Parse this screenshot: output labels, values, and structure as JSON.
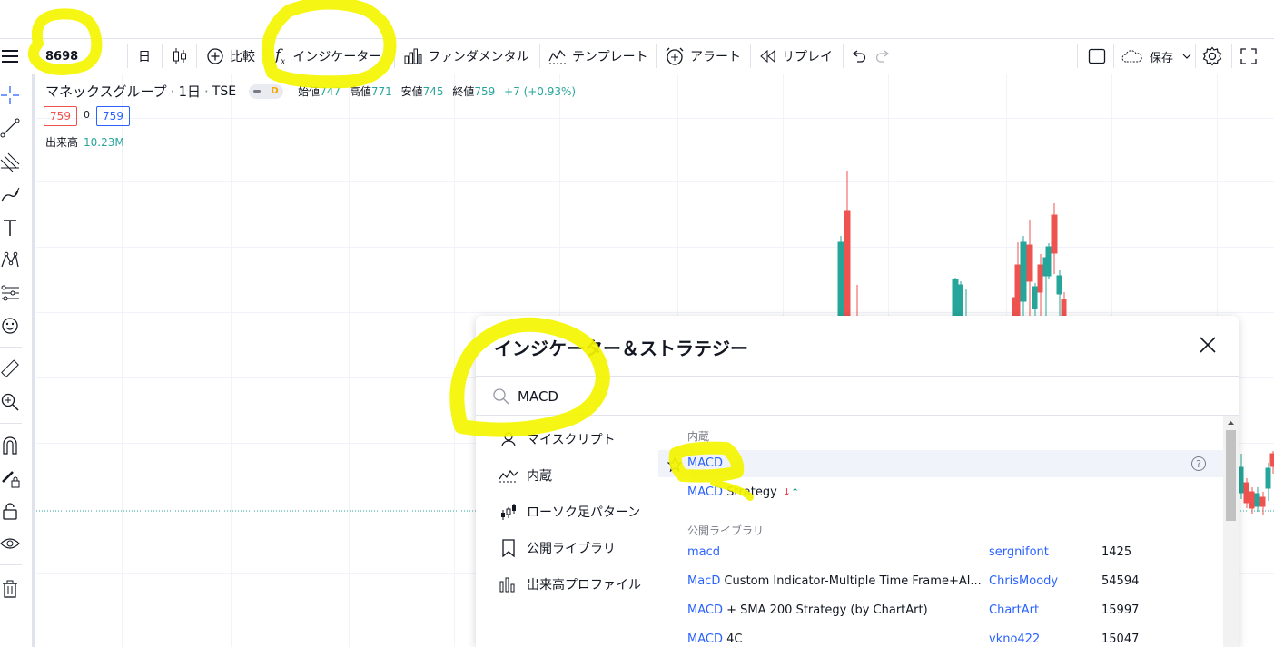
{
  "toolbar": {
    "symbol": "8698",
    "interval": "日",
    "compare": "比較",
    "indicators": "インジケーター",
    "fundamentals": "ファンダメンタル",
    "template": "テンプレート",
    "alert": "アラート",
    "replay": "リプレイ",
    "save": "保存"
  },
  "legend": {
    "name": "マネックスグループ",
    "interval": "1日",
    "exchange": "TSE",
    "pill_letter": "D",
    "open_label": "始値",
    "open": "747",
    "high_label": "高値",
    "high": "771",
    "low_label": "安値",
    "low": "745",
    "close_label": "終値",
    "close": "759",
    "change": "+7 (+0.93%)",
    "sell_price": "759",
    "spread": "0",
    "buy_price": "759",
    "volume_label": "出来高",
    "volume": "10.23M"
  },
  "dialog": {
    "title": "インジケーター＆ストラテジー",
    "search_value": "MACD",
    "categories": [
      {
        "icon": "user-icon",
        "label": "マイスクリプト"
      },
      {
        "icon": "builtin-chart-icon",
        "label": "内蔵"
      },
      {
        "icon": "candle-pattern-icon",
        "label": "ローソク足パターン"
      },
      {
        "icon": "bookmark-icon",
        "label": "公開ライブラリ"
      },
      {
        "icon": "volume-profile-icon",
        "label": "出来高プロファイル"
      }
    ],
    "builtin_header": "内蔵",
    "builtin": [
      {
        "hit": "MACD",
        "rest": ""
      },
      {
        "hit": "MACD",
        "rest": " Strategy",
        "arrows_down": "↓",
        "arrows_up": "↑"
      }
    ],
    "public_header": "公開ライブラリ",
    "public": [
      {
        "hit": "macd",
        "rest": "",
        "author": "sergnifont",
        "count": "1425"
      },
      {
        "hit": "MacD",
        "rest": " Custom Indicator-Multiple Time Frame+Al...",
        "author": "ChrisMoody",
        "count": "54594"
      },
      {
        "hit": "MACD",
        "rest": " + SMA 200 Strategy (by ChartArt)",
        "author": "ChartArt",
        "count": "15997"
      },
      {
        "hit": "MACD",
        "rest": " 4C",
        "author": "vkno422",
        "count": "15047"
      }
    ]
  },
  "colors": {
    "up": "#26a69a",
    "down": "#ef5350",
    "accent": "#2962ff",
    "highlight": "#f5f500"
  }
}
